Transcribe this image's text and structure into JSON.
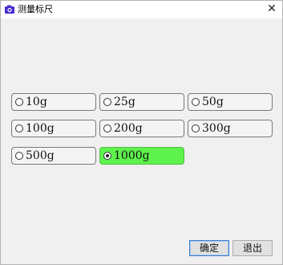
{
  "window": {
    "title": "测量标尺",
    "close_glyph": "✕",
    "app_icon": "camera-icon"
  },
  "options": [
    {
      "label": "10g",
      "checked": false
    },
    {
      "label": "25g",
      "checked": false
    },
    {
      "label": "50g",
      "checked": false
    },
    {
      "label": "100g",
      "checked": false
    },
    {
      "label": "200g",
      "checked": false
    },
    {
      "label": "300g",
      "checked": false
    },
    {
      "label": "500g",
      "checked": false
    },
    {
      "label": "1000g",
      "checked": true
    }
  ],
  "buttons": {
    "ok_label": "确定",
    "exit_label": "退出"
  },
  "colors": {
    "selected_bg": "#5ef24d",
    "icon_color": "#4a2bd1"
  }
}
